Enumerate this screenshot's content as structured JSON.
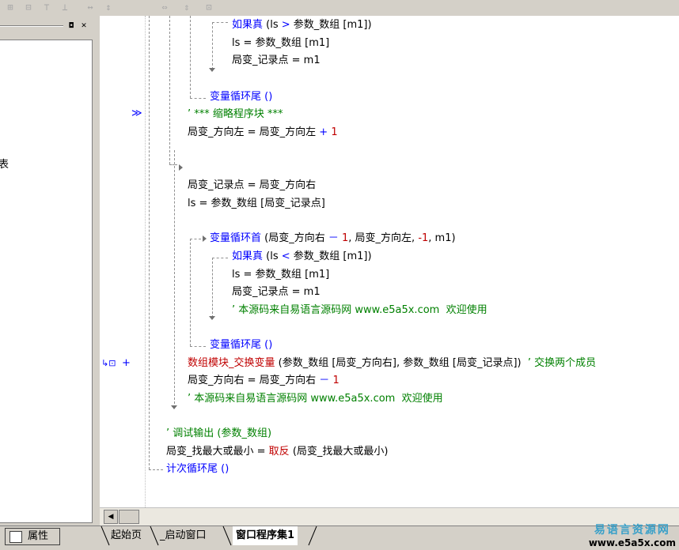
{
  "toolbar": {
    "icons": [
      "align-left-icon",
      "align-center-icon",
      "align-top-icon",
      "align-middle-icon",
      "space-horizontal-icon",
      "space-vertical-icon",
      "same-width-icon",
      "same-height-icon",
      "same-size-icon"
    ]
  },
  "left_panel": {
    "partial_text": "表"
  },
  "code": {
    "l1": {
      "kw": "如果真",
      "a": " (ls ",
      "op": ">",
      "b": " 参数_数组 [m1])"
    },
    "l2": "ls = 参数_数组 [m1]",
    "l3": "局变_记录点 = m1",
    "l4": "变量循环尾 ()",
    "l5": "’ *** 缩略程序块 ***",
    "l6": {
      "a": "局变_方向左 = 局变_方向左 ",
      "op": "+",
      "num": " 1"
    },
    "l7": "局变_记录点 = 局变_方向右",
    "l8": "ls = 参数_数组 [局变_记录点]",
    "l9": {
      "kw": "变量循环首",
      "a": " (局变_方向右 ",
      "op1": "－",
      "n1": " 1",
      "b": ", 局变_方向左, ",
      "n2": "-1",
      "c": ", m1)"
    },
    "l10": {
      "kw": "如果真",
      "a": " (ls ",
      "op": "<",
      "b": " 参数_数组 [m1])"
    },
    "l11": "ls = 参数_数组 [m1]",
    "l12": "局变_记录点 = m1",
    "l13": "’ 本源码来自易语言源码网 www.e5a5x.com  欢迎使用",
    "l14": "变量循环尾 ()",
    "l15": {
      "fn": "数组模块_交换变量",
      "a": " (参数_数组 [局变_方向右], 参数_数组 [局变_记录点]) ",
      "cm": " ’ 交换两个成员"
    },
    "l16": {
      "a": "局变_方向右 = 局变_方向右 ",
      "op": "－",
      "num": " 1"
    },
    "l17": "’ 本源码来自易语言源码网 www.e5a5x.com  欢迎使用",
    "l18": "’ 调试输出 (参数_数组)",
    "l19": {
      "a": "局变_找最大或最小 = ",
      "fn": "取反",
      "b": " (局变_找最大或最小)"
    },
    "l20": "计次循环尾 ()"
  },
  "gutter": {
    "collapsed_marker": "≫",
    "breakpoint_marker": "+"
  },
  "bottom": {
    "properties_tab": "属性",
    "tabs": [
      "起始页",
      "_启动窗口",
      "窗口程序集1"
    ],
    "active_tab": "窗口程序集1",
    "watermark_line1": "易语言资源网",
    "watermark_line2": "www.e5a5x.com"
  },
  "colors": {
    "keyword": "#0000ff",
    "function": "#c00000",
    "comment": "#008000",
    "chrome": "#d4d0c8"
  }
}
